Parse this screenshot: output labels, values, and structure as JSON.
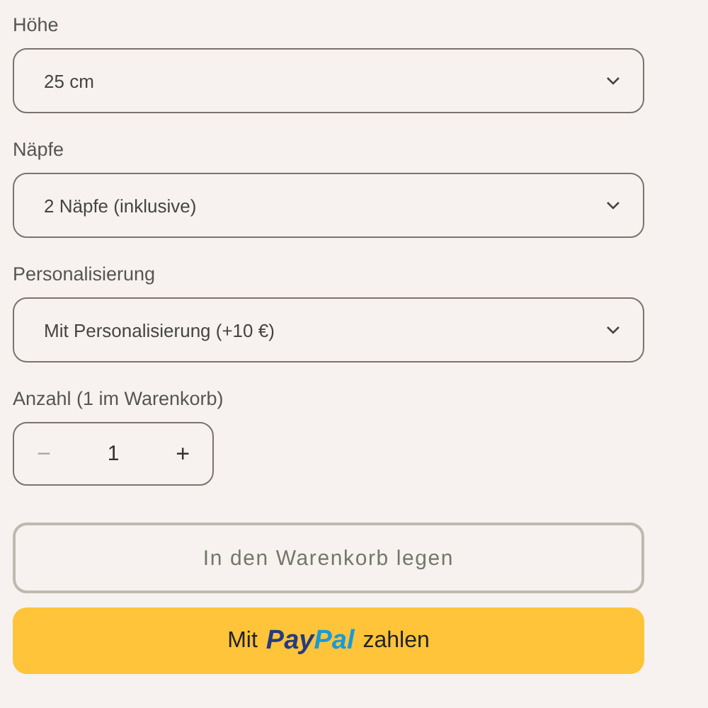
{
  "selects": [
    {
      "label": "Höhe",
      "value": "25 cm"
    },
    {
      "label": "Näpfe",
      "value": "2 Näpfe (inklusive)"
    },
    {
      "label": "Personalisierung",
      "value": "Mit Personalisierung (+10 €)"
    }
  ],
  "quantity": {
    "label": "Anzahl (1 im Warenkorb)",
    "decrement": "−",
    "value": "1",
    "increment": "+",
    "decrement_disabled": true
  },
  "add_to_cart": {
    "label": "In den Warenkorb legen"
  },
  "paypal": {
    "prefix": "Mit",
    "logo": [
      "Pay",
      "Pal"
    ],
    "suffix": "zahlen"
  }
}
